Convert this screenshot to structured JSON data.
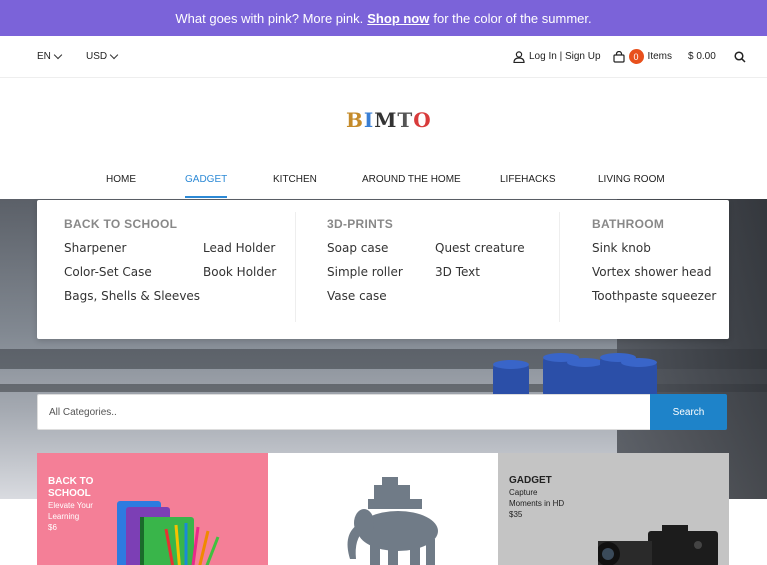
{
  "announcement": {
    "text_before": "What goes with pink? More pink.",
    "link": "Shop now",
    "text_after": "for the color of the summer."
  },
  "utility": {
    "language": "EN",
    "currency": "USD",
    "login": "Log In | Sign Up",
    "cart_count": "0",
    "items_label": "Items",
    "cart_total": "$ 0.00"
  },
  "logo": {
    "letters": [
      "B",
      "I",
      "M",
      "T",
      "O"
    ]
  },
  "nav": {
    "home": "HOME",
    "gadget": "GADGET",
    "kitchen": "KITCHEN",
    "around": "AROUND THE HOME",
    "lifehacks": "LIFEHACKS",
    "living": "LIVING ROOM"
  },
  "mega": {
    "col1": {
      "title": "BACK TO SCHOOL",
      "items": [
        "Sharpener",
        "Color-Set Case",
        "Bags, Shells & Sleeves",
        "Lead Holder",
        "Book Holder"
      ]
    },
    "col2": {
      "title": "3D-PRINTS",
      "items": [
        "Soap case",
        "Simple roller",
        "Vase case",
        "Quest creature",
        "3D Text"
      ]
    },
    "col3": {
      "title": "BATHROOM",
      "items": [
        "Sink knob",
        "Vortex shower head",
        "Toothpaste squeezer"
      ]
    }
  },
  "search": {
    "placeholder": "All Categories..",
    "button": "Search"
  },
  "tiles": {
    "pink": {
      "line1": "BACK TO",
      "line2": "SCHOOL",
      "sub1": "Elevate Your",
      "sub2": "Learning",
      "price": "$6"
    },
    "gray": {
      "title": "GADGET",
      "sub1": "Capture",
      "sub2": "Moments in HD",
      "price": "$35"
    }
  },
  "colors": {
    "announcement_bg": "#7b63d9",
    "accent": "#2d8ad6",
    "badge": "#e8501c",
    "search_button": "#1e83c9",
    "tile_pink": "#f47f97",
    "tile_gray": "#c4c4c4"
  }
}
